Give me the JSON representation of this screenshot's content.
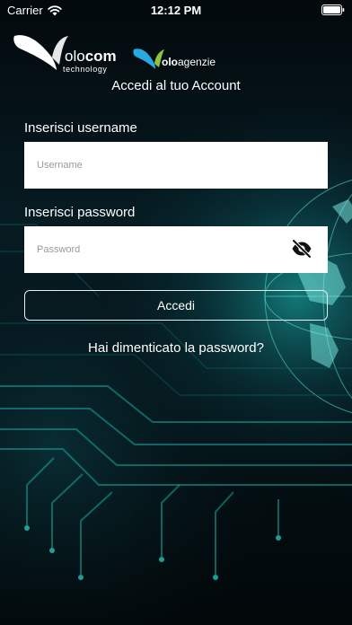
{
  "status_bar": {
    "carrier": "Carrier",
    "time": "12:12 PM"
  },
  "brand": {
    "volocom_name_part1": "olo",
    "volocom_name_part2": "com",
    "volocom_sub": "technology",
    "voloagenzie_name_part1": "olo",
    "voloagenzie_name_part2": "agenzie"
  },
  "login": {
    "title": "Accedi al tuo Account",
    "username_label": "Inserisci username",
    "username_placeholder": "Username",
    "password_label": "Inserisci password",
    "password_placeholder": "Password",
    "submit_label": "Accedi",
    "forgot_password": "Hai dimenticato la password?"
  },
  "colors": {
    "background": "#051319",
    "accent_glow": "#19c9c0",
    "field_background": "#ffffff",
    "voloagenzie_blue": "#2aa8e0",
    "voloagenzie_green": "#8cc43c"
  },
  "icons": {
    "wifi": "wifi-icon",
    "battery": "battery-icon",
    "password_visibility": "eye-slash-icon"
  }
}
